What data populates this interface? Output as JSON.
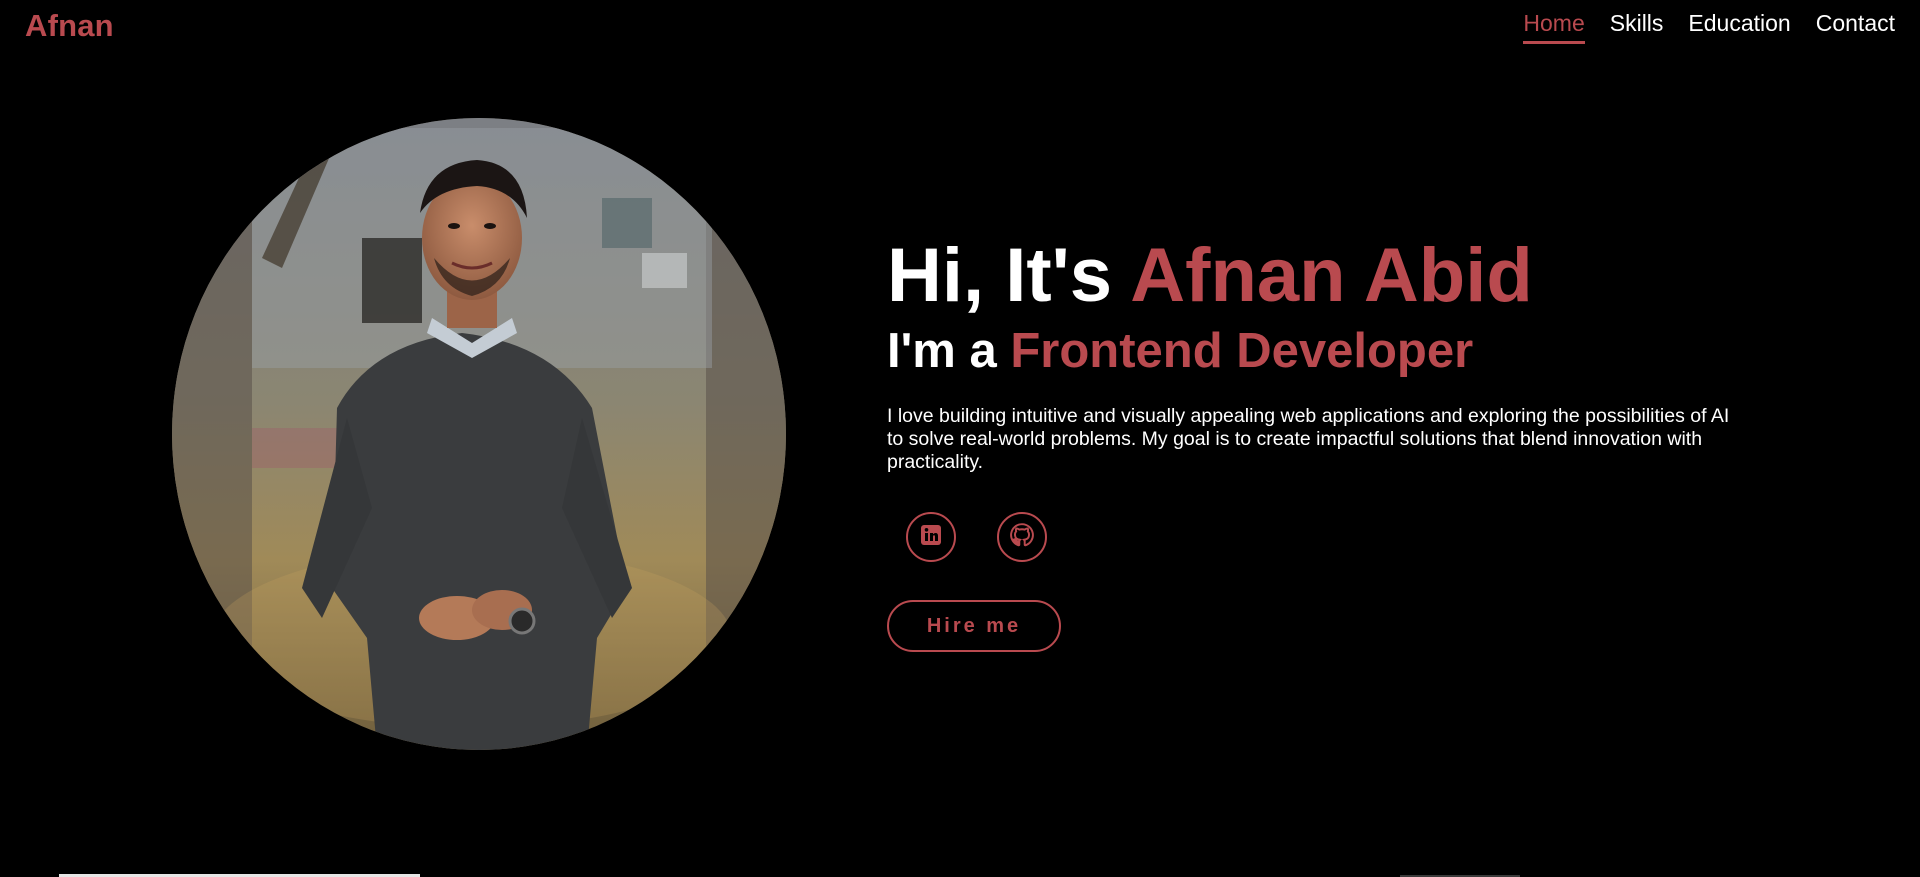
{
  "brand": {
    "logo": "Afnan"
  },
  "nav": {
    "links": [
      {
        "label": "Home",
        "active": true
      },
      {
        "label": "Skills",
        "active": false
      },
      {
        "label": "Education",
        "active": false
      },
      {
        "label": "Contact",
        "active": false
      }
    ]
  },
  "hero": {
    "greeting_prefix": "Hi, It's ",
    "name": "Afnan Abid",
    "role_prefix": "I'm a ",
    "role": "Frontend Developer",
    "description": "I love building intuitive and visually appealing web applications and exploring the possibilities of AI to solve real-world problems. My goal is to create impactful solutions that blend innovation with practicality.",
    "hire_button": "Hire me"
  },
  "socials": [
    {
      "icon": "linkedin-icon"
    },
    {
      "icon": "github-icon"
    }
  ],
  "colors": {
    "accent": "#b94a4f",
    "background": "#000000",
    "text": "#ffffff"
  }
}
